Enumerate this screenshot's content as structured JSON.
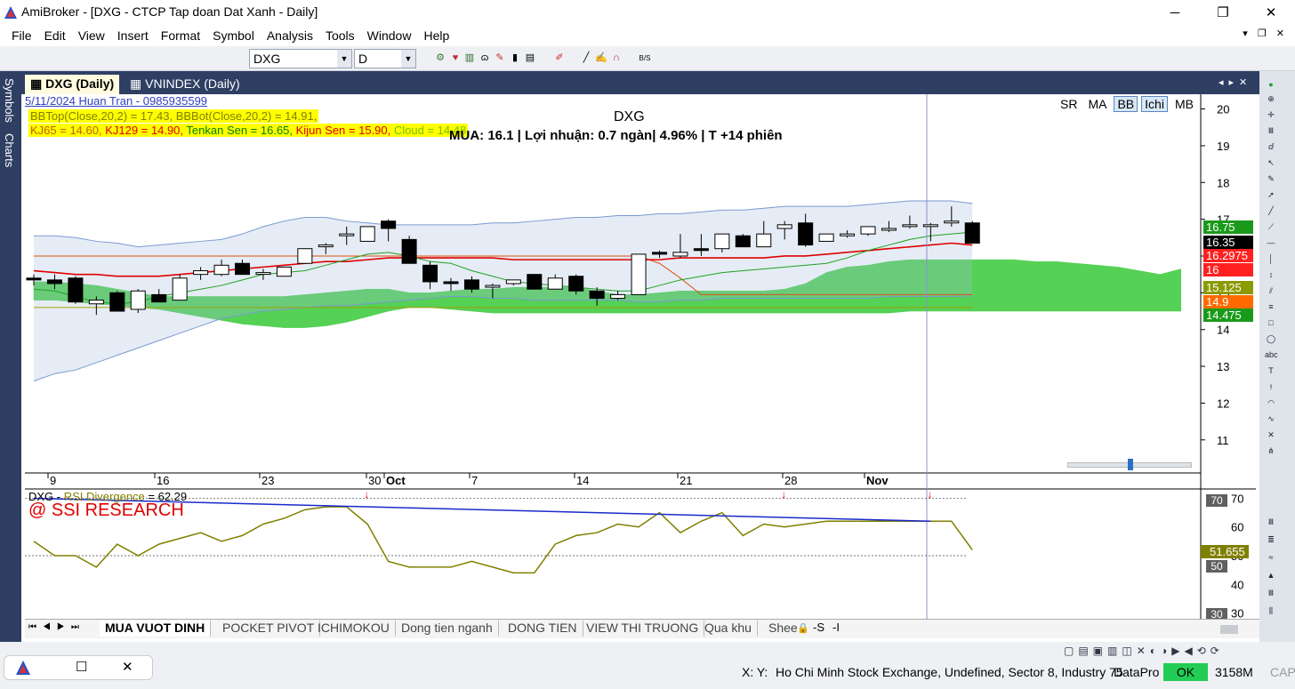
{
  "window": {
    "title": "AmiBroker - [DXG - CTCP Tap doan Dat Xanh - Daily]"
  },
  "menu": [
    "File",
    "Edit",
    "View",
    "Insert",
    "Format",
    "Symbol",
    "Analysis",
    "Tools",
    "Window",
    "Help"
  ],
  "toolbar": {
    "symbol": "DXG",
    "interval": "D"
  },
  "left_dock": {
    "symbols": "Symbols",
    "charts": "Charts"
  },
  "doc_tabs": {
    "active": "DXG (Daily)",
    "second": "VNINDEX (Daily)"
  },
  "chart": {
    "date_author": "5/11/2024     Huan Tran - 0985935599",
    "legend_bb": {
      "top": "BBTop(Close,20,2) = 17.43, ",
      "bot": "BBBot(Close,20,2) = 14.91,"
    },
    "legend_ichi": {
      "kj65": "KJ65 = 14.60, ",
      "kj129": "KJ129 = 14.90, ",
      "tenkan": "Tenkan Sen = 16.65, ",
      "kijun": "Kijun Sen = 15.90, ",
      "cloud": "Cloud = 14.48"
    },
    "title": "DXG",
    "signal": "MUA: 16.1 | Lợi nhuận: 0.7 ngàn| 4.96% | T +14 phiên",
    "indicator_buttons": [
      "SR",
      "MA",
      "BB",
      "Ichi",
      "MB"
    ],
    "active_buttons": [
      "BB",
      "Ichi"
    ],
    "price_labels": [
      {
        "text": "16.75",
        "color": "#1a9a1a"
      },
      {
        "text": "16.35",
        "color": "#000000"
      },
      {
        "text": "16.2975",
        "color": "#ff2020"
      },
      {
        "text": "16",
        "color": "#ff2020"
      },
      {
        "text": "15.125",
        "color": "#8a9a00"
      },
      {
        "text": "14.9",
        "color": "#ff6a00"
      },
      {
        "text": "14.475",
        "color": "#1a9a1a"
      }
    ]
  },
  "chart_data": {
    "type": "candlestick",
    "y_ticks": [
      11,
      12,
      13,
      14,
      15,
      16,
      17,
      18,
      19,
      20
    ],
    "ylim": [
      10.1,
      20.4
    ],
    "x_labels": [
      "9",
      "16",
      "23",
      "30",
      "Oct",
      "7",
      "14",
      "21",
      "28",
      "Nov"
    ],
    "candles": [
      {
        "o": 15.4,
        "h": 15.5,
        "l": 15.2,
        "c": 15.35
      },
      {
        "o": 15.35,
        "h": 15.5,
        "l": 15.1,
        "c": 15.25
      },
      {
        "o": 15.4,
        "h": 15.45,
        "l": 14.7,
        "c": 14.75
      },
      {
        "o": 14.7,
        "h": 14.9,
        "l": 14.4,
        "c": 14.8
      },
      {
        "o": 15.0,
        "h": 15.05,
        "l": 14.5,
        "c": 14.5
      },
      {
        "o": 14.55,
        "h": 15.1,
        "l": 14.45,
        "c": 15.05
      },
      {
        "o": 14.95,
        "h": 15.1,
        "l": 14.85,
        "c": 14.75
      },
      {
        "o": 14.8,
        "h": 15.5,
        "l": 14.8,
        "c": 15.4
      },
      {
        "o": 15.5,
        "h": 15.7,
        "l": 15.35,
        "c": 15.6
      },
      {
        "o": 15.5,
        "h": 15.9,
        "l": 15.45,
        "c": 15.75
      },
      {
        "o": 15.8,
        "h": 15.9,
        "l": 15.5,
        "c": 15.5
      },
      {
        "o": 15.55,
        "h": 15.65,
        "l": 15.35,
        "c": 15.55
      },
      {
        "o": 15.45,
        "h": 15.7,
        "l": 15.45,
        "c": 15.7
      },
      {
        "o": 15.8,
        "h": 16.2,
        "l": 15.8,
        "c": 16.2
      },
      {
        "o": 16.3,
        "h": 16.35,
        "l": 16.05,
        "c": 16.3
      },
      {
        "o": 16.6,
        "h": 16.8,
        "l": 16.3,
        "c": 16.6
      },
      {
        "o": 16.4,
        "h": 16.8,
        "l": 16.4,
        "c": 16.8
      },
      {
        "o": 16.95,
        "h": 17.0,
        "l": 16.4,
        "c": 16.75
      },
      {
        "o": 16.45,
        "h": 16.55,
        "l": 15.8,
        "c": 15.8
      },
      {
        "o": 15.75,
        "h": 15.85,
        "l": 15.1,
        "c": 15.3
      },
      {
        "o": 15.3,
        "h": 15.4,
        "l": 15.05,
        "c": 15.25
      },
      {
        "o": 15.35,
        "h": 15.45,
        "l": 15.0,
        "c": 15.1
      },
      {
        "o": 15.2,
        "h": 15.25,
        "l": 14.85,
        "c": 15.2
      },
      {
        "o": 15.25,
        "h": 15.35,
        "l": 15.2,
        "c": 15.35
      },
      {
        "o": 15.5,
        "h": 15.5,
        "l": 15.1,
        "c": 15.1
      },
      {
        "o": 15.1,
        "h": 15.5,
        "l": 15.1,
        "c": 15.4
      },
      {
        "o": 15.45,
        "h": 15.5,
        "l": 14.95,
        "c": 15.05
      },
      {
        "o": 15.05,
        "h": 15.15,
        "l": 14.65,
        "c": 14.85
      },
      {
        "o": 14.85,
        "h": 15.05,
        "l": 14.8,
        "c": 14.95
      },
      {
        "o": 14.95,
        "h": 16.05,
        "l": 14.95,
        "c": 16.05
      },
      {
        "o": 16.1,
        "h": 16.15,
        "l": 15.95,
        "c": 16.05
      },
      {
        "o": 16.0,
        "h": 16.6,
        "l": 15.95,
        "c": 16.1
      },
      {
        "o": 16.2,
        "h": 16.6,
        "l": 16.0,
        "c": 16.15
      },
      {
        "o": 16.2,
        "h": 16.6,
        "l": 16.1,
        "c": 16.6
      },
      {
        "o": 16.55,
        "h": 16.6,
        "l": 16.25,
        "c": 16.25
      },
      {
        "o": 16.25,
        "h": 16.95,
        "l": 16.25,
        "c": 16.6
      },
      {
        "o": 16.75,
        "h": 16.95,
        "l": 16.45,
        "c": 16.85
      },
      {
        "o": 16.9,
        "h": 17.15,
        "l": 16.25,
        "c": 16.3
      },
      {
        "o": 16.4,
        "h": 16.6,
        "l": 16.4,
        "c": 16.6
      },
      {
        "o": 16.55,
        "h": 16.7,
        "l": 16.5,
        "c": 16.6
      },
      {
        "o": 16.6,
        "h": 16.8,
        "l": 16.55,
        "c": 16.8
      },
      {
        "o": 16.75,
        "h": 16.95,
        "l": 16.65,
        "c": 16.75
      },
      {
        "o": 16.85,
        "h": 17.1,
        "l": 16.75,
        "c": 16.85
      },
      {
        "o": 16.85,
        "h": 16.9,
        "l": 16.4,
        "c": 16.85
      },
      {
        "o": 16.9,
        "h": 17.35,
        "l": 16.8,
        "c": 16.95
      },
      {
        "o": 16.9,
        "h": 16.95,
        "l": 16.35,
        "c": 16.35
      }
    ],
    "bb_top": [
      16.55,
      16.55,
      16.5,
      16.4,
      16.35,
      16.25,
      16.3,
      16.35,
      16.4,
      16.45,
      16.6,
      16.8,
      16.95,
      17.05,
      17.05,
      16.95,
      16.9,
      16.85,
      16.85,
      16.85,
      16.85,
      16.85,
      16.9,
      16.9,
      16.95,
      17.0,
      17.05,
      17.05,
      17.1,
      17.1,
      17.15,
      17.15,
      17.2,
      17.25,
      17.25,
      17.3,
      17.35,
      17.35,
      17.35,
      17.35,
      17.4,
      17.45,
      17.5,
      17.5,
      17.5,
      17.43
    ],
    "bb_bot": [
      12.6,
      12.8,
      12.9,
      13.1,
      13.3,
      13.5,
      13.7,
      13.9,
      14.1,
      14.3,
      14.4,
      14.5,
      14.55,
      14.6,
      14.65,
      14.65,
      14.7,
      14.75,
      14.8,
      14.85,
      14.9,
      14.9,
      14.85,
      14.85,
      14.8,
      14.8,
      14.8,
      14.8,
      14.8,
      14.75,
      14.75,
      14.8,
      14.8,
      14.85,
      14.85,
      14.85,
      14.85,
      14.85,
      14.85,
      14.85,
      14.85,
      14.9,
      14.9,
      14.9,
      14.9,
      14.91
    ],
    "cloud_a": [
      15.3,
      15.3,
      15.25,
      15.2,
      15.1,
      15.0,
      14.9,
      14.9,
      14.9,
      14.9,
      14.9,
      14.9,
      14.9,
      14.95,
      15.0,
      15.05,
      15.1,
      15.1,
      15.0,
      15.0,
      15.05,
      15.1,
      15.1,
      15.15,
      15.15,
      15.15,
      15.15,
      15.05,
      14.95,
      14.95,
      15.0,
      15.05,
      15.05,
      15.05,
      15.05,
      15.05,
      15.1,
      15.25,
      15.55,
      15.7,
      15.75,
      15.85,
      15.9,
      15.9,
      15.9,
      15.9,
      15.9,
      15.9,
      15.85,
      15.85,
      15.8,
      15.75,
      15.7,
      15.6,
      15.5,
      15.65
    ],
    "cloud_b": [
      14.8,
      14.8,
      14.75,
      14.7,
      14.65,
      14.6,
      14.55,
      14.45,
      14.35,
      14.25,
      14.15,
      14.1,
      14.05,
      14.05,
      14.1,
      14.2,
      14.35,
      14.5,
      14.6,
      14.6,
      14.55,
      14.5,
      14.45,
      14.45,
      14.45,
      14.45,
      14.45,
      14.45,
      14.45,
      14.45,
      14.45,
      14.45,
      14.45,
      14.45,
      14.45,
      14.45,
      14.45,
      14.45,
      14.45,
      14.45,
      14.45,
      14.45,
      14.5,
      14.5,
      14.5,
      14.5,
      14.5,
      14.5,
      14.5,
      14.5,
      14.5,
      14.5,
      14.5,
      14.5,
      14.5,
      14.5
    ],
    "tenkan": [
      15.1,
      15.05,
      14.9,
      14.75,
      14.7,
      14.75,
      14.9,
      15.0,
      15.1,
      15.2,
      15.35,
      15.5,
      15.55,
      15.6,
      15.75,
      15.9,
      16.05,
      16.1,
      16.0,
      15.85,
      15.8,
      15.6,
      15.45,
      15.3,
      15.25,
      15.2,
      15.15,
      15.1,
      15.05,
      15.05,
      15.2,
      15.35,
      15.45,
      15.55,
      15.6,
      15.65,
      15.7,
      15.75,
      15.8,
      15.95,
      16.15,
      16.3,
      16.45,
      16.55,
      16.6,
      16.65
    ],
    "kijun": [
      16.0,
      16.0,
      16.0,
      16.0,
      16.0,
      16.0,
      16.0,
      16.0,
      16.0,
      16.0,
      16.0,
      16.0,
      16.0,
      16.0,
      16.0,
      16.0,
      16.0,
      16.0,
      16.0,
      16.0,
      16.0,
      16.0,
      16.0,
      16.0,
      16.0,
      16.0,
      16.0,
      16.0,
      16.0,
      16.0,
      15.8,
      15.4,
      14.95,
      14.95,
      14.95,
      14.95,
      14.95,
      14.95,
      14.95,
      14.95,
      14.95,
      14.95,
      14.95,
      14.95,
      14.95,
      14.95
    ],
    "ma_red": [
      15.6,
      15.55,
      15.5,
      15.5,
      15.45,
      15.45,
      15.45,
      15.5,
      15.55,
      15.6,
      15.65,
      15.7,
      15.75,
      15.8,
      15.85,
      15.85,
      15.9,
      15.95,
      15.95,
      15.95,
      15.95,
      15.95,
      15.95,
      15.9,
      15.9,
      15.9,
      15.9,
      15.9,
      15.9,
      15.9,
      15.9,
      15.95,
      15.95,
      15.95,
      15.95,
      15.95,
      16.0,
      16.0,
      16.05,
      16.1,
      16.15,
      16.2,
      16.25,
      16.3,
      16.35,
      16.3
    ],
    "kj65": [
      14.6,
      14.6,
      14.6,
      14.6,
      14.6,
      14.6,
      14.6,
      14.6,
      14.6,
      14.6,
      14.6,
      14.6,
      14.6,
      14.6,
      14.6,
      14.6,
      14.6,
      14.6,
      14.6,
      14.6,
      14.6,
      14.6,
      14.6,
      14.6,
      14.6,
      14.6,
      14.6,
      14.6,
      14.6,
      14.6,
      14.6,
      14.6,
      14.6,
      14.6,
      14.6,
      14.6,
      14.6,
      14.6,
      14.6,
      14.6,
      14.6,
      14.6,
      14.6,
      14.6,
      14.6,
      14.6
    ],
    "rsi_values": [
      55,
      50,
      50,
      46,
      54,
      50,
      54,
      56,
      58,
      55,
      57,
      61,
      63,
      66,
      67,
      67,
      61,
      48,
      46,
      46,
      46,
      48,
      46,
      44,
      44,
      54,
      57,
      58,
      61,
      60,
      65,
      58,
      62,
      65,
      57,
      61,
      60,
      61,
      62,
      62,
      62,
      62,
      62,
      62,
      62,
      52
    ],
    "rsi_ylim": [
      28,
      72
    ],
    "rsi_ticks": [
      30,
      40,
      50,
      60,
      70
    ],
    "rsi_hlines": [
      50,
      70
    ],
    "rsi_divergence_line": [
      70,
      62
    ],
    "rsi_arrow_indices": [
      16,
      36,
      43
    ]
  },
  "rsi_panel": {
    "label_prefix": "DXG - ",
    "label_name": "RSI Divergence",
    "label_value": " = 62.29",
    "watermark": "@ SSI RESEARCH",
    "value_box": "51.655",
    "level_70": "70",
    "level_50": "50",
    "level_30": "30"
  },
  "sheet_tabs": [
    "MUA VUOT DINH",
    "POCKET PIVOT",
    "ICHIMOKOU",
    "Dong tien nganh",
    "DONG TIEN",
    "VIEW THI TRUONG",
    "Qua khu",
    "Shee"
  ],
  "sheet_extra": [
    "-S",
    "-I"
  ],
  "status": {
    "xy": "X:  Y:",
    "exchange": "Ho Chi Minh Stock Exchange, Undefined, Sector 8, Industry 75",
    "source": "DataPro",
    "ok": "OK",
    "mem": "3158M",
    "cap": "CAP"
  }
}
